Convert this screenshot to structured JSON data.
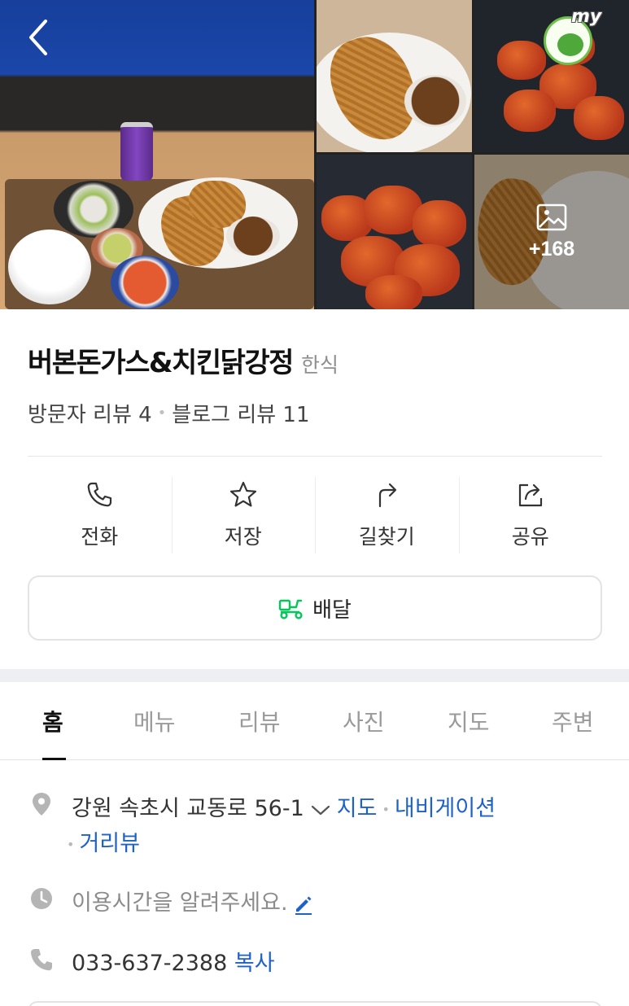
{
  "gallery": {
    "more_count": "+168",
    "badge_text": "my"
  },
  "place": {
    "name": "버본돈가스&치킨닭강정",
    "category": "한식",
    "visitor_review_label": "방문자 리뷰 4",
    "blog_review_label": "블로그 리뷰 11"
  },
  "actions": [
    {
      "label": "전화",
      "icon": "phone-icon"
    },
    {
      "label": "저장",
      "icon": "star-icon"
    },
    {
      "label": "길찾기",
      "icon": "directions-icon"
    },
    {
      "label": "공유",
      "icon": "share-icon"
    }
  ],
  "delivery": {
    "label": "배달",
    "icon": "delivery-scooter-icon",
    "color": "#03c75a"
  },
  "tabs": [
    {
      "label": "홈",
      "active": true
    },
    {
      "label": "메뉴",
      "active": false
    },
    {
      "label": "리뷰",
      "active": false
    },
    {
      "label": "사진",
      "active": false
    },
    {
      "label": "지도",
      "active": false
    },
    {
      "label": "주변",
      "active": false
    }
  ],
  "info": {
    "address": "강원 속초시 교동로 56-1",
    "map_link": "지도",
    "navigation_link": "내비게이션",
    "street_view_link": "거리뷰",
    "hours_prompt": "이용시간을 알려주세요.",
    "phone": "033-637-2388",
    "copy_link": "복사"
  },
  "colors": {
    "link": "#1f62c6",
    "brand_green": "#03c75a",
    "section_gap": "#eeeff2"
  }
}
